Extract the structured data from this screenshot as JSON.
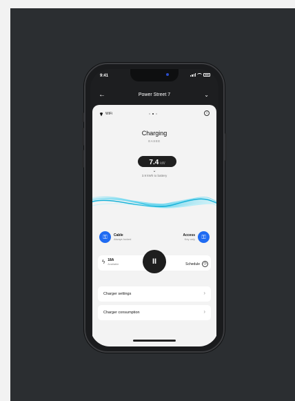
{
  "status_bar": {
    "time": "9:41"
  },
  "header": {
    "title": "Power Street 7",
    "back_glyph": "←",
    "chevron_glyph": "⌄"
  },
  "card": {
    "wifi_label": "WiFi",
    "info_glyph": "i",
    "status_title": "Charging",
    "brand": "EASEE",
    "power_value": "7.4",
    "power_unit": "kW",
    "expand_glyph": "⌄",
    "energy_text": "3.9 kWh to battery"
  },
  "features": {
    "cable": {
      "title": "Cable",
      "subtitle": "Always locked",
      "icon": "lock-icon"
    },
    "access": {
      "title": "Access",
      "subtitle": "Key only",
      "icon": "key-lock-icon"
    }
  },
  "controls": {
    "amps_value": "18A",
    "amps_subtitle": "Available",
    "pause_glyph": "II",
    "schedule_label": "Schedule"
  },
  "menu": [
    {
      "label": "Charger settings"
    },
    {
      "label": "Charger consumption"
    }
  ],
  "colors": {
    "accent": "#1f6bf2",
    "background": "#2b2e31",
    "card": "#f3f3f3",
    "wave": "#2ec4e6"
  }
}
